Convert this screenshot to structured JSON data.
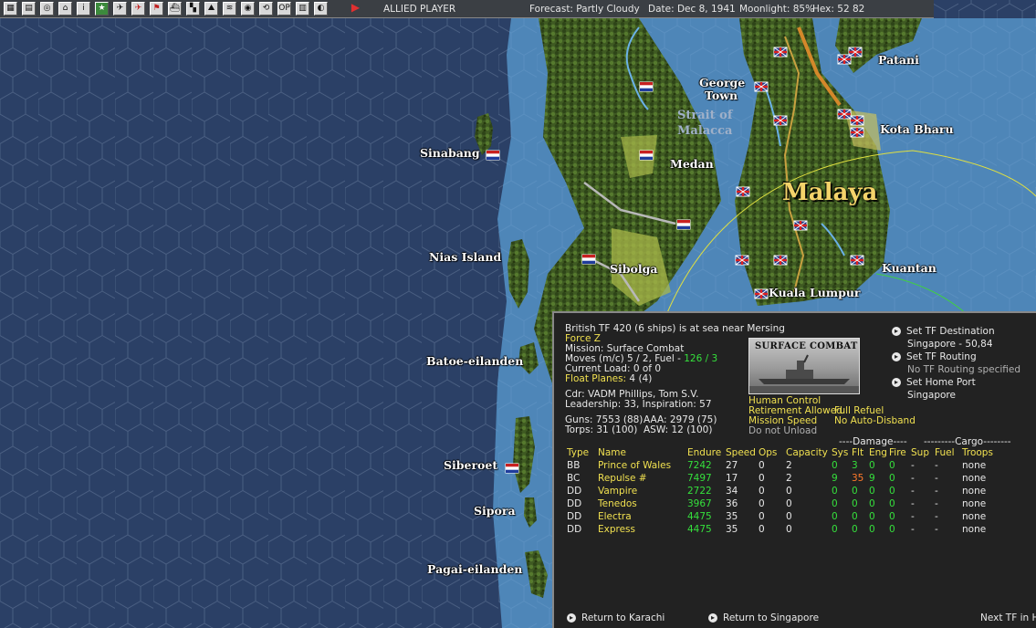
{
  "toolbar": {
    "icons": [
      "map-icon",
      "document-icon",
      "globe-icon",
      "base-icon",
      "info-icon",
      "star-icon",
      "plane-icon",
      "plane-red-icon",
      "flag-icon",
      "ship-icon",
      "chart-icon",
      "terrain-icon",
      "line-icon",
      "earth-icon",
      "cycle-icon",
      "op-icon",
      "list-icon",
      "moon-icon",
      "play-icon"
    ],
    "player": "ALLIED PLAYER",
    "forecast": "Forecast: Partly Cloudy",
    "date": "Date: Dec 8, 1941",
    "moonlight": "Moonlight: 85%",
    "hex": "Hex: 52 82"
  },
  "map_labels": {
    "patani": "Patani",
    "george_town_1": "George",
    "george_town_2": "Town",
    "strait_1": "Strait of",
    "strait_2": "Malacca",
    "kota_bharu": "Kota Bharu",
    "sinabang": "Sinabang",
    "medan": "Medan",
    "malaya": "Malaya",
    "nias": "Nias Island",
    "sibolga": "Sibolga",
    "kuantan": "Kuantan",
    "kuala_lumpur": "Kuala Lumpur",
    "batoe": "Batoe-eilanden",
    "siberoet": "Siberoet",
    "sipora": "Sipora",
    "pagai": "Pagai-eilanden"
  },
  "panel": {
    "header": "British TF 420 (6 ships) is at sea near Mersing",
    "force_name": "Force Z",
    "mission": "Mission: Surface Combat",
    "moves_prefix": "Moves (m/c)  5 / 2,  Fuel - ",
    "fuel_value": "126 / 3",
    "current_load": "Current Load:  0 of 0",
    "float_planes_label": "Float Planes:",
    "float_planes_value": "4 (4)",
    "cdr": "Cdr: VADM Phillips, Tom S.V.",
    "leadership": "Leadership: 33, Inspiration: 57",
    "guns": "Guns: 7553 (88)",
    "aaa": "AAA: 2979 (75)",
    "torps": "Torps: 31 (100)",
    "asw": "ASW: 12 (100)",
    "photo_caption": "SURFACE COMBAT",
    "human_control": "Human Control",
    "retirement": "Retirement Allowed",
    "full_refuel": "Full Refuel",
    "mission_speed": "Mission Speed",
    "no_auto_disband": "No Auto-Disband",
    "do_not_unload": "Do not Unload",
    "set_destination": "Set TF Destination",
    "destination_value": "Singapore - 50,84",
    "set_routing": "Set TF Routing",
    "routing_value": "No TF Routing specified",
    "set_home": "Set Home Port",
    "home_value": "Singapore",
    "damage_group": "----Damage----",
    "cargo_group": "---------Cargo--------",
    "columns": [
      "Type",
      "Name",
      "Endure",
      "Speed",
      "Ops",
      "Capacity",
      "Sys",
      "Flt",
      "Eng",
      "Fire",
      "Sup",
      "Fuel",
      "Troops"
    ],
    "ships": [
      {
        "type": "BB",
        "name": "Prince of Wales",
        "endure": "7242",
        "speed": "27",
        "ops": "0",
        "cap": "2",
        "sys": "0",
        "flt": "3",
        "eng": "0",
        "fire": "0",
        "sup": "-",
        "fuel": "-",
        "troops": "none"
      },
      {
        "type": "BC",
        "name": "Repulse #",
        "endure": "7497",
        "speed": "17",
        "ops": "0",
        "cap": "2",
        "sys": "9",
        "flt": "35",
        "eng": "9",
        "fire": "0",
        "sup": "-",
        "fuel": "-",
        "troops": "none"
      },
      {
        "type": "DD",
        "name": "Vampire",
        "endure": "2722",
        "speed": "34",
        "ops": "0",
        "cap": "0",
        "sys": "0",
        "flt": "0",
        "eng": "0",
        "fire": "0",
        "sup": "-",
        "fuel": "-",
        "troops": "none"
      },
      {
        "type": "DD",
        "name": "Tenedos",
        "endure": "3967",
        "speed": "36",
        "ops": "0",
        "cap": "0",
        "sys": "0",
        "flt": "0",
        "eng": "0",
        "fire": "0",
        "sup": "-",
        "fuel": "-",
        "troops": "none"
      },
      {
        "type": "DD",
        "name": "Electra",
        "endure": "4475",
        "speed": "35",
        "ops": "0",
        "cap": "0",
        "sys": "0",
        "flt": "0",
        "eng": "0",
        "fire": "0",
        "sup": "-",
        "fuel": "-",
        "troops": "none"
      },
      {
        "type": "DD",
        "name": "Express",
        "endure": "4475",
        "speed": "35",
        "ops": "0",
        "cap": "0",
        "sys": "0",
        "flt": "0",
        "eng": "0",
        "fire": "0",
        "sup": "-",
        "fuel": "-",
        "troops": "none"
      }
    ],
    "return_karachi": "Return to Karachi",
    "return_singapore": "Return to Singapore",
    "next_tf": "Next TF in He"
  }
}
